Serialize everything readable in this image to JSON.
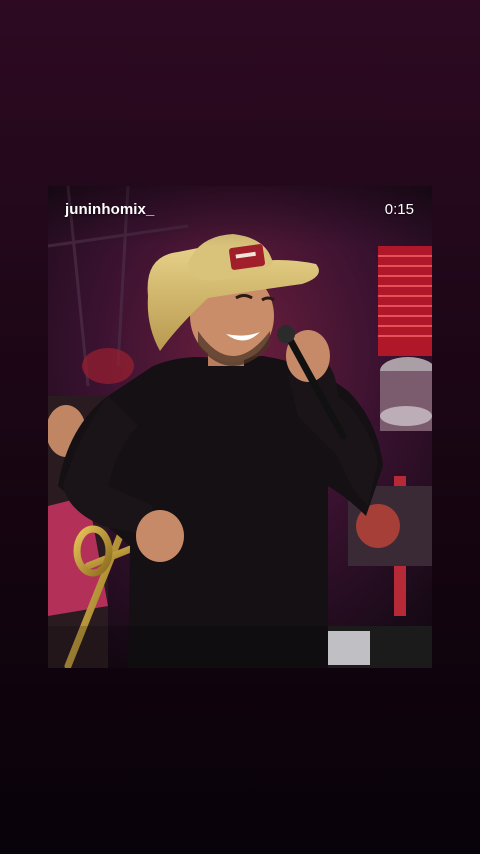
{
  "story": {
    "username": "juninhomix_",
    "elapsed_time": "0:15"
  },
  "photo": {
    "subject": "singer-in-cowboy-hat-holding-microphone-on-stage"
  },
  "colors": {
    "background_top": "#2d0a22",
    "background_bottom": "#08020a",
    "text": "#ffffff"
  }
}
